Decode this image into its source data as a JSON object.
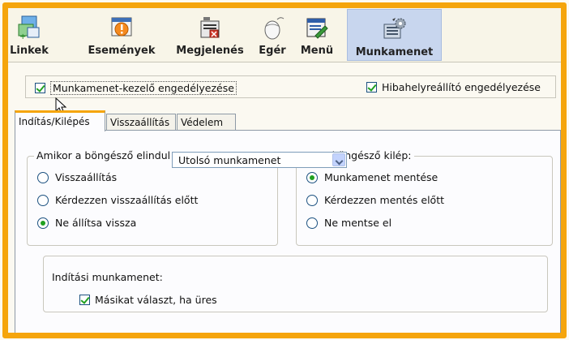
{
  "toolbar": {
    "items": [
      {
        "label": "Linkek",
        "icon": "links-icon"
      },
      {
        "label": "Események",
        "icon": "events-icon"
      },
      {
        "label": "Megjelenés",
        "icon": "appearance-icon"
      },
      {
        "label": "Egér",
        "icon": "mouse-icon"
      },
      {
        "label": "Menü",
        "icon": "menu-icon"
      },
      {
        "label": "Munkamenet",
        "icon": "session-icon",
        "active": true
      }
    ]
  },
  "top_options": {
    "session_manager": {
      "label": "Munkamenet-kezelő engedélyezése",
      "checked": true
    },
    "crash_recovery": {
      "label": "Hibahelyreállító engedélyezése",
      "checked": true
    }
  },
  "tabs": [
    "Indítás/Kilépés",
    "Visszaállítás",
    "Védelem"
  ],
  "startup_group": {
    "legend": "Amikor a böngésző elindul",
    "options": [
      "Visszaállítás",
      "Kérdezzen visszaállítás előtt",
      "Ne állítsa vissza"
    ],
    "selected_index": 2
  },
  "exit_group": {
    "legend": "Ha a böngésző kilép:",
    "options": [
      "Munkamenet mentése",
      "Kérdezzen mentés előtt",
      "Ne mentse el"
    ],
    "selected_index": 0
  },
  "startup_session": {
    "label": "Indítási munkamenet:",
    "selected": "Utolsó munkamenet",
    "fallback_checkbox": {
      "label": "Másikat választ, ha üres",
      "checked": true
    }
  },
  "colors": {
    "accent_border": "#f5a50c",
    "check_green": "#21a121",
    "active_tab_bg": "#c8d6ee"
  }
}
